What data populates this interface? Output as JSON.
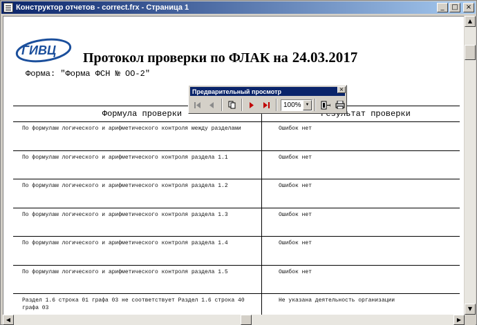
{
  "window": {
    "title": "Конструктор отчетов - correct.frx - Страница 1",
    "buttons": {
      "minimize": "_",
      "maximize": "□",
      "close": "×"
    }
  },
  "report": {
    "logo_text": "ГИВЦ",
    "title": "Протокол проверки по ФЛАК на",
    "date": "24.03.2017",
    "form_line": "Форма: \"Форма ФСН № ОО-2\"",
    "columns": [
      "Формула проверки",
      "Результат проверки"
    ],
    "rows": [
      {
        "formula": "По формулам логического и арифметического контроля между разделами",
        "result": "Ошибок нет"
      },
      {
        "formula": "По формулам логического и арифметического контроля раздела 1.1",
        "result": "Ошибок нет"
      },
      {
        "formula": "По формулам логического и арифметического контроля раздела 1.2",
        "result": "Ошибок нет"
      },
      {
        "formula": "По формулам логического и арифметического контроля раздела 1.3",
        "result": "Ошибок нет"
      },
      {
        "formula": "По формулам логического и арифметического контроля раздела 1.4",
        "result": "Ошибок нет"
      },
      {
        "formula": "По формулам логического и арифметического контроля раздела 1.5",
        "result": "Ошибок нет"
      },
      {
        "formula": "Раздел 1.6 строка 01 графа 03 не соответствует Раздел 1.6 строка 40 графа 03",
        "result": "Не указана деятельность организации"
      }
    ]
  },
  "preview_toolbar": {
    "title": "Предварительный просмотр",
    "zoom": "100%"
  },
  "colors": {
    "titlebar": "#0a246a",
    "logo_blue": "#1b4f9c",
    "nav_red": "#c00000"
  }
}
